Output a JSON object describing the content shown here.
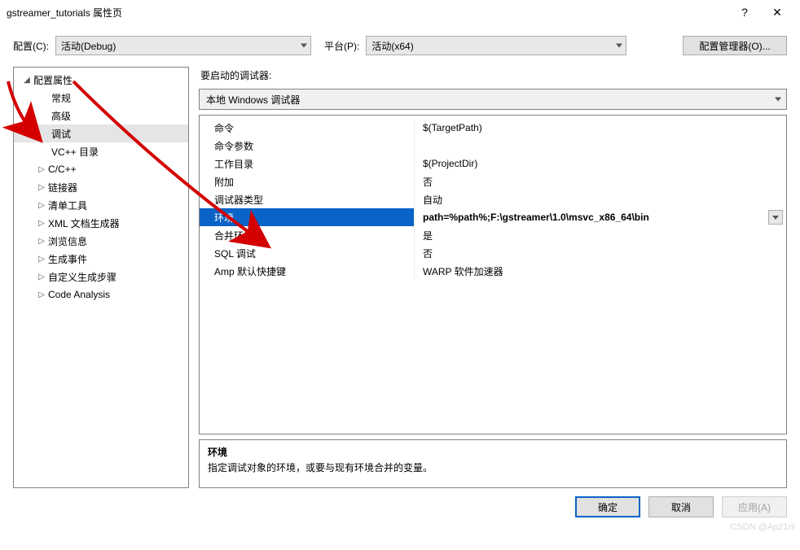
{
  "titlebar": {
    "title": "gstreamer_tutorials 属性页",
    "help": "?",
    "close": "✕"
  },
  "toprow": {
    "config_label": "配置(C):",
    "config_value": "活动(Debug)",
    "platform_label": "平台(P):",
    "platform_value": "活动(x64)",
    "manager": "配置管理器(O)..."
  },
  "tree": {
    "root": "配置属性",
    "items": [
      {
        "label": "常规",
        "indent": "lv1b"
      },
      {
        "label": "高级",
        "indent": "lv1b"
      },
      {
        "label": "调试",
        "indent": "lv1b",
        "selected": true
      },
      {
        "label": "VC++ 目录",
        "indent": "lv1b"
      },
      {
        "label": "C/C++",
        "indent": "lv1",
        "expandable": true
      },
      {
        "label": "链接器",
        "indent": "lv1",
        "expandable": true
      },
      {
        "label": "清单工具",
        "indent": "lv1",
        "expandable": true
      },
      {
        "label": "XML 文档生成器",
        "indent": "lv1",
        "expandable": true
      },
      {
        "label": "浏览信息",
        "indent": "lv1",
        "expandable": true
      },
      {
        "label": "生成事件",
        "indent": "lv1",
        "expandable": true
      },
      {
        "label": "自定义生成步骤",
        "indent": "lv1",
        "expandable": true
      },
      {
        "label": "Code Analysis",
        "indent": "lv1",
        "expandable": true
      }
    ]
  },
  "right": {
    "launch_label": "要启动的调试器:",
    "debugger": "本地 Windows 调试器",
    "props": [
      {
        "key": "命令",
        "val": "$(TargetPath)"
      },
      {
        "key": "命令参数",
        "val": ""
      },
      {
        "key": "工作目录",
        "val": "$(ProjectDir)"
      },
      {
        "key": "附加",
        "val": "否"
      },
      {
        "key": "调试器类型",
        "val": "自动"
      },
      {
        "key": "环境",
        "val": "path=%path%;F:\\gstreamer\\1.0\\msvc_x86_64\\bin",
        "selected": true,
        "dd": true
      },
      {
        "key": "合并环境",
        "val": "是"
      },
      {
        "key": "SQL 调试",
        "val": "否"
      },
      {
        "key": "Amp 默认快捷键",
        "val": "WARP 软件加速器"
      }
    ],
    "desc": {
      "title": "环境",
      "text": "指定调试对象的环境，或要与现有环境合并的变量。"
    }
  },
  "buttons": {
    "ok": "确定",
    "cancel": "取消",
    "apply": "应用(A)"
  },
  "watermark": "CSDN @Ap21ril"
}
